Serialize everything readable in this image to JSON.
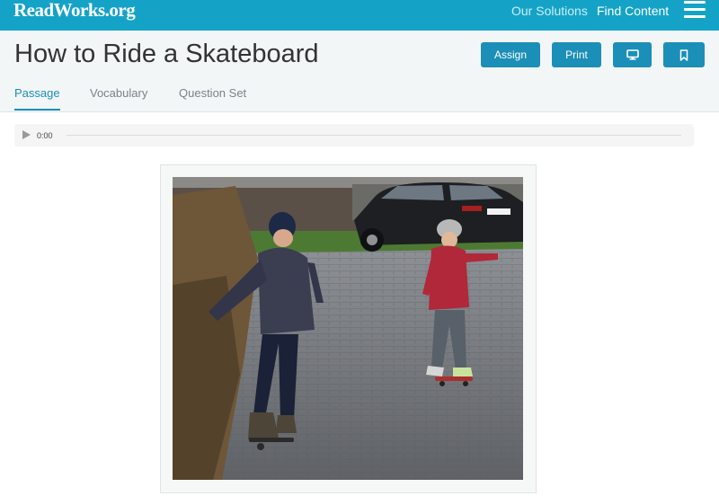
{
  "topbar": {
    "logo": "ReadWorks.org",
    "links": [
      "Our Solutions",
      "Find Content"
    ],
    "menu_icon": "hamburger-icon",
    "color": "#14a3c7"
  },
  "header": {
    "title": "How to Ride a Skateboard",
    "buttons": {
      "assign": "Assign",
      "print": "Print",
      "present_icon": "monitor-icon",
      "bookmark_icon": "bookmark-icon"
    },
    "button_color": "#1b8fb8"
  },
  "tabs": [
    {
      "label": "Passage",
      "active": true
    },
    {
      "label": "Vocabulary",
      "active": false
    },
    {
      "label": "Question Set",
      "active": false
    }
  ],
  "audio": {
    "play_icon": "play-icon",
    "time": "0:00",
    "progress": 0
  },
  "passage": {
    "image_icon": "skateboarding-children-photo"
  }
}
